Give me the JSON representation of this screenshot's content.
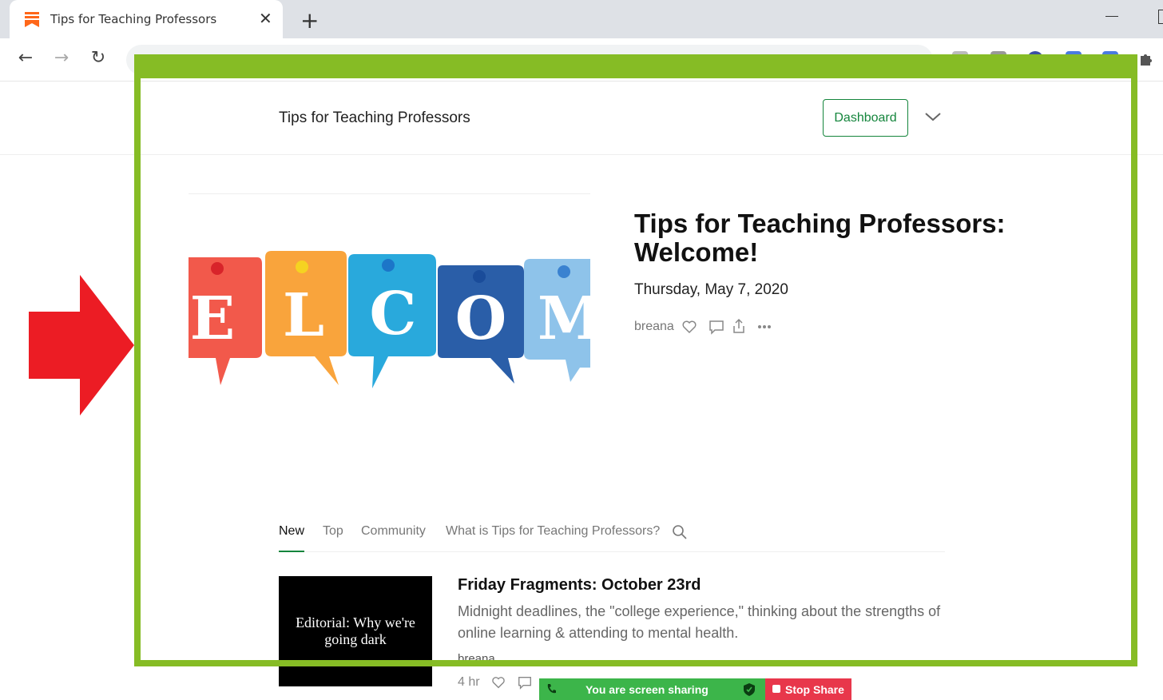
{
  "browser": {
    "tab_title": "Tips for Teaching Professors",
    "tab_close": "✕",
    "new_tab": "+",
    "back": "←",
    "forward": "→",
    "reload": "↻"
  },
  "header": {
    "site_name": "Tips for Teaching Professors",
    "dashboard_label": "Dashboard"
  },
  "hero": {
    "image_letters": [
      "E",
      "L",
      "C",
      "O",
      "M"
    ],
    "title": "Tips for Teaching Professors: Welcome!",
    "date": "Thursday, May 7, 2020",
    "author": "breana"
  },
  "feed_tabs": {
    "new": "New",
    "top": "Top",
    "community": "Community",
    "about": "What is Tips for Teaching Professors?"
  },
  "post": {
    "thumb_text": "Editorial: Why we're going dark",
    "title": "Friday Fragments: October 23rd",
    "subtitle": "Midnight deadlines, the \"college experience,\" thinking about the strengths of online learning & attending to mental health.",
    "author": "breana",
    "time": "4 hr"
  },
  "screen_share": {
    "status": "You are screen sharing",
    "stop_label": "Stop Share"
  },
  "colors": {
    "accent": "#14853c",
    "frame": "#86bc25",
    "arrow": "#ec1c24",
    "share_green": "#3cb54a",
    "stop_red": "#e8374b"
  }
}
